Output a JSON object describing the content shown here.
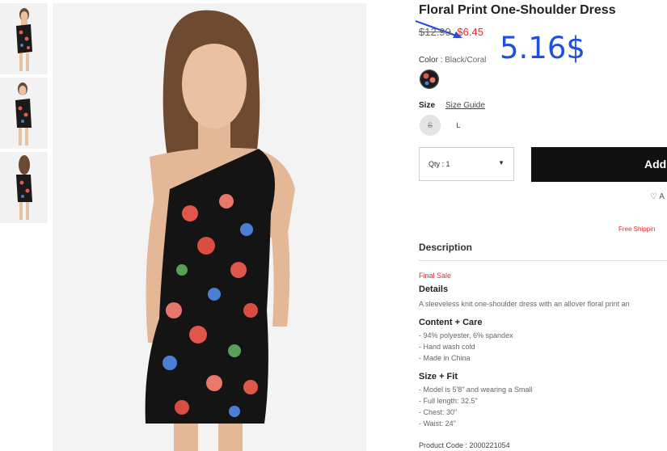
{
  "product": {
    "title": "Floral Print One-Shoulder Dress",
    "old_price": "$12.90",
    "sale_price": "$6.45"
  },
  "annotation": {
    "text": "5.16$",
    "color": "#1f4fe0"
  },
  "color_option": {
    "label": "Color :",
    "value": "Black/Coral"
  },
  "size": {
    "label": "Size",
    "guide_link": "Size Guide",
    "options": [
      {
        "label": "S",
        "available": false
      },
      {
        "label": "L",
        "available": true
      }
    ]
  },
  "quantity": {
    "label": "Qty : 1"
  },
  "actions": {
    "add_label": "Add",
    "wishlist_label": "A"
  },
  "shipping_text": "Free Shippin",
  "description": {
    "title": "Description",
    "final_sale": "Final Sale",
    "details_title": "Details",
    "details_text": "A sleeveless knit one-shoulder dress with an allover floral print an",
    "content_title": "Content + Care",
    "content_items": [
      "- 94% polyester, 6% spandex",
      "- Hand wash cold",
      "- Made in China"
    ],
    "fit_title": "Size + Fit",
    "fit_items": [
      "- Model is 5'8\" and wearing a Small",
      "- Full length: 32.5\"",
      "- Chest: 30\"",
      "- Waist: 24\""
    ],
    "product_code": "Product Code : 2000221054"
  },
  "colors": {
    "sale_red": "#e8262b",
    "button_black": "#111111",
    "annotation_blue": "#1f4fe0"
  }
}
